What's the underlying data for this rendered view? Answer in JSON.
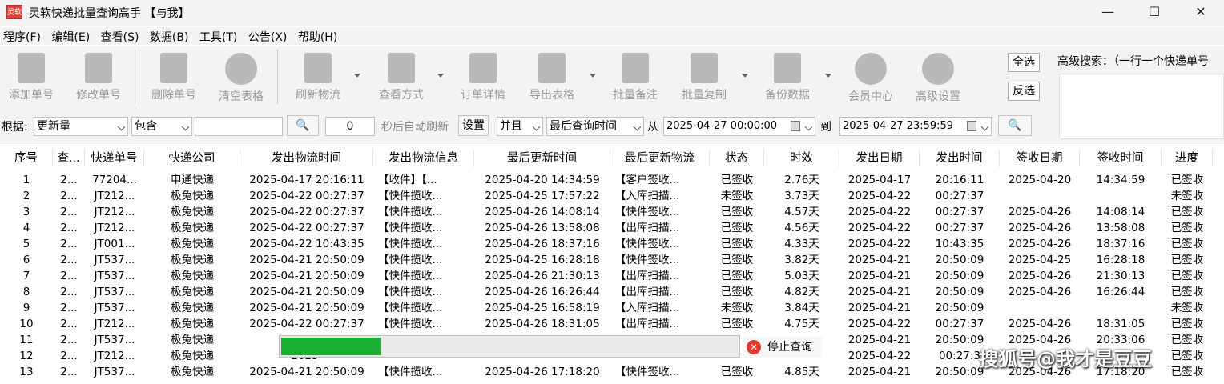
{
  "window": {
    "app_icon_text": "灵软",
    "title": "灵软快递批量查询高手 【与我】"
  },
  "menu": [
    "程序(F)",
    "编辑(E)",
    "查看(S)",
    "数据(B)",
    "工具(T)",
    "公告(X)",
    "帮助(H)"
  ],
  "toolbar": {
    "buttons": [
      {
        "label": "添加单号",
        "icon": "add-icon"
      },
      {
        "label": "修改单号",
        "icon": "edit-icon"
      },
      {
        "label": "删除单号",
        "icon": "delete-icon"
      },
      {
        "label": "清空表格",
        "icon": "clear-icon"
      },
      {
        "label": "刷新物流",
        "icon": "refresh-icon"
      },
      {
        "label": "查看方式",
        "icon": "view-icon"
      },
      {
        "label": "订单详情",
        "icon": "detail-icon"
      },
      {
        "label": "导出表格",
        "icon": "export-icon"
      },
      {
        "label": "批量备注",
        "icon": "note-icon"
      },
      {
        "label": "批量复制",
        "icon": "copy-icon"
      },
      {
        "label": "备份数据",
        "icon": "backup-icon"
      },
      {
        "label": "会员中心",
        "icon": "clock-icon"
      },
      {
        "label": "高级设置",
        "icon": "settings-icon"
      }
    ],
    "select_all": "全选",
    "invert_select": "反选",
    "adv_search_label": "高级搜索：（一行一个快递单号"
  },
  "filter": {
    "basis_label": "根据:",
    "basis_value": "更新量",
    "match_value": "包含",
    "keyword_value": "",
    "search_icon": "search-icon",
    "auto_refresh_value": "0",
    "auto_refresh_label": "秒后自动刷新",
    "settings_label": "设置",
    "logic_value": "并且",
    "time_field_value": "最后查询时间",
    "from_label": "从",
    "from_value": "2025-04-27 00:00:00",
    "to_label": "到",
    "to_value": "2025-04-27 23:59:59"
  },
  "table": {
    "headers": [
      "序号",
      "查...",
      "快递单号",
      "快递公司",
      "发出物流时间",
      "发出物流信息",
      "最后更新时间",
      "最后更新物流",
      "状态",
      "时效",
      "发出日期",
      "发出时间",
      "签收日期",
      "签收时间",
      "进度"
    ],
    "rows": [
      [
        "1",
        "2...",
        "77204...",
        "申通快递",
        "2025-04-17 20:16:11",
        "【收件】【...",
        "2025-04-20 14:34:59",
        "【客户签收...",
        "已签收",
        "2.76天",
        "2025-04-17",
        "20:16:11",
        "2025-04-20",
        "14:34:59",
        "已签收"
      ],
      [
        "2",
        "2...",
        "JT212...",
        "极兔快递",
        "2025-04-22 00:27:37",
        "【快件揽收...",
        "2025-04-25 17:57:22",
        "【入库扫描...",
        "未签收",
        "3.73天",
        "2025-04-22",
        "00:27:37",
        "",
        "",
        "未签收"
      ],
      [
        "3",
        "2...",
        "JT212...",
        "极兔快递",
        "2025-04-22 00:27:37",
        "【快件揽收...",
        "2025-04-26 14:08:14",
        "【快件签收...",
        "已签收",
        "4.57天",
        "2025-04-22",
        "00:27:37",
        "2025-04-26",
        "14:08:14",
        "已签收"
      ],
      [
        "4",
        "2...",
        "JT212...",
        "极兔快递",
        "2025-04-22 00:27:37",
        "【快件揽收...",
        "2025-04-26 13:58:08",
        "【出库扫描...",
        "已签收",
        "4.56天",
        "2025-04-22",
        "00:27:37",
        "2025-04-26",
        "13:58:08",
        "已签收"
      ],
      [
        "5",
        "2...",
        "JT001...",
        "极兔快递",
        "2025-04-22 10:43:35",
        "【快件揽收...",
        "2025-04-26 18:37:16",
        "【快件签收...",
        "已签收",
        "4.33天",
        "2025-04-22",
        "10:43:35",
        "2025-04-26",
        "18:37:16",
        "已签收"
      ],
      [
        "6",
        "2...",
        "JT537...",
        "极兔快递",
        "2025-04-21 20:50:09",
        "【快件揽收...",
        "2025-04-25 16:28:18",
        "【快件签收...",
        "已签收",
        "3.82天",
        "2025-04-21",
        "20:50:09",
        "2025-04-25",
        "16:28:18",
        "已签收"
      ],
      [
        "7",
        "2...",
        "JT537...",
        "极兔快递",
        "2025-04-21 20:50:09",
        "【快件揽收...",
        "2025-04-26 21:30:13",
        "【出库扫描...",
        "已签收",
        "5.03天",
        "2025-04-21",
        "20:50:09",
        "2025-04-26",
        "21:30:13",
        "已签收"
      ],
      [
        "8",
        "2...",
        "JT537...",
        "极兔快递",
        "2025-04-21 20:50:09",
        "【快件揽收...",
        "2025-04-26 16:26:44",
        "【出库扫描...",
        "已签收",
        "4.82天",
        "2025-04-21",
        "20:50:09",
        "2025-04-26",
        "16:26:44",
        "已签收"
      ],
      [
        "9",
        "2...",
        "JT537...",
        "极兔快递",
        "2025-04-21 20:50:09",
        "【快件揽收...",
        "2025-04-25 16:58:19",
        "【入库扫描...",
        "未签收",
        "3.84天",
        "2025-04-21",
        "20:50:09",
        "",
        "",
        "未签收"
      ],
      [
        "10",
        "2...",
        "JT212...",
        "极兔快递",
        "2025-04-22 00:27:37",
        "【快件揽收...",
        "2025-04-26 18:31:05",
        "【出库扫描...",
        "已签收",
        "4.75天",
        "2025-04-22",
        "00:27:37",
        "2025-04-26",
        "18:31:05",
        "已签收"
      ],
      [
        "11",
        "2...",
        "JT537...",
        "极兔快递",
        "2025-",
        "",
        "",
        "",
        "",
        "",
        "2025-04-21",
        "20:50:09",
        "2025-04-26",
        "20:33:06",
        "已签收"
      ],
      [
        "12",
        "2...",
        "JT212...",
        "极兔快递",
        "2025-",
        "",
        "",
        "",
        "",
        "",
        "2025-04-22",
        "00:27:3",
        "",
        "",
        "已签收"
      ],
      [
        "13",
        "2...",
        "JT537...",
        "极兔快递",
        "2025-04-21 20:50:09",
        "【快件揽收...",
        "2025-04-26 17:18:20",
        "【快件签收...",
        "已签收",
        "4.85天",
        "2025-04-21",
        "20:50:09",
        "2025-04-26",
        "17:18:20",
        "已签收"
      ]
    ]
  },
  "progress": {
    "fraction": 0.22,
    "stop_label": "停止查询"
  },
  "watermark": "搜狐号@我才是豆豆",
  "colors": {
    "progress_fill": "#1aae32",
    "stop_icon": "#e0392f"
  }
}
